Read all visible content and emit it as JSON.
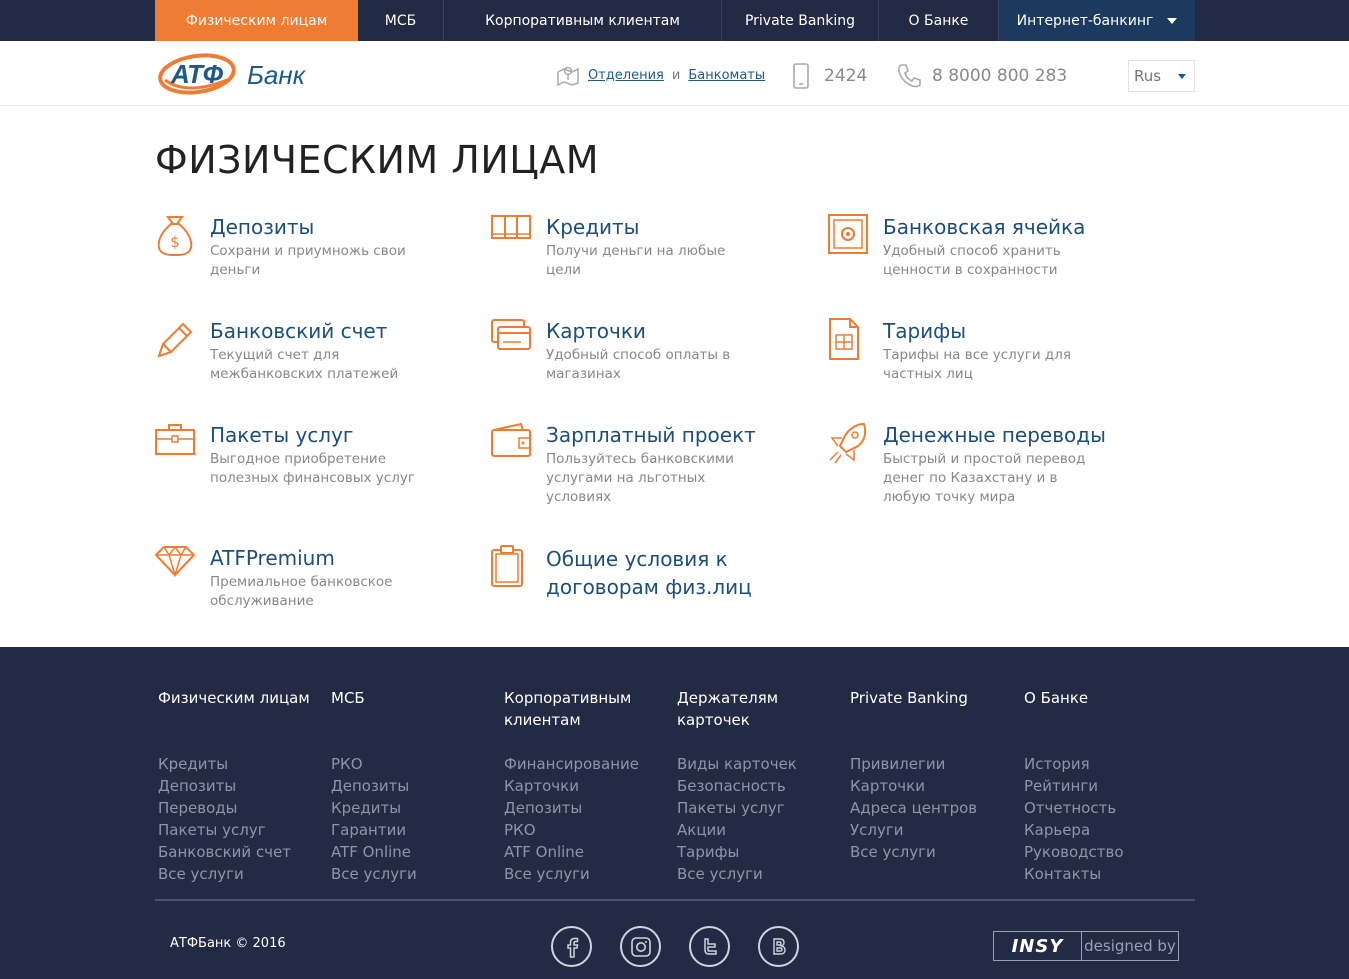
{
  "topnav": {
    "items": [
      {
        "label": "Физическим лицам"
      },
      {
        "label": "МСБ"
      },
      {
        "label": "Корпоративным клиентам"
      },
      {
        "label": "Private Banking"
      },
      {
        "label": "О Банке"
      },
      {
        "label": "Интернет-банкинг"
      }
    ]
  },
  "header": {
    "logo_text_1": "АТФ",
    "logo_text_2": "Банк",
    "branches_link": "Отделения",
    "branches_and": "и",
    "atms_link": "Банкоматы",
    "phone_short": "2424",
    "phone_long": "8 8000 800 283",
    "lang": "Rus"
  },
  "main": {
    "title": "ФИЗИЧЕСКИМ ЛИЦАМ",
    "services": [
      {
        "title": "Депозиты",
        "desc": "Сохрани и приумножь свои деньги",
        "icon": "money-bag-icon"
      },
      {
        "title": "Кредиты",
        "desc": "Получи деньги на любые цели",
        "icon": "book-icon"
      },
      {
        "title": "Банковская ячейка",
        "desc": "Удобный способ хранить ценности в сохранности",
        "icon": "safe-icon"
      },
      {
        "title": "Банковский счет",
        "desc": "Текущий счет для межбанковских платежей",
        "icon": "pen-icon"
      },
      {
        "title": "Карточки",
        "desc": "Удобный способ оплаты в магазинах",
        "icon": "cards-icon"
      },
      {
        "title": "Тарифы",
        "desc": "Тарифы на все услуги для частных лиц",
        "icon": "document-icon"
      },
      {
        "title": "Пакеты услуг",
        "desc": "Выгодное приобретение полезных финансовых услуг",
        "icon": "briefcase-icon"
      },
      {
        "title": "Зарплатный проект",
        "desc": "Пользуйтесь банковскими услугами на льготных условиях",
        "icon": "wallet-icon"
      },
      {
        "title": "Денежные переводы",
        "desc": "Быстрый и простой перевод денег по Казахстану и в любую точку мира",
        "icon": "rocket-icon"
      },
      {
        "title": "ATFPremium",
        "desc": "Премиальное банковское обслуживание",
        "icon": "diamond-icon"
      },
      {
        "title": "Общие условия к договорам физ.лиц",
        "desc": "",
        "icon": "clipboard-icon"
      }
    ]
  },
  "footer": {
    "columns": [
      {
        "head": "Физическим лицам",
        "links": [
          "Кредиты",
          "Депозиты",
          "Переводы",
          "Пакеты услуг",
          "Банковский счет",
          "Все услуги"
        ]
      },
      {
        "head": "МСБ",
        "links": [
          "РКО",
          "Депозиты",
          "Кредиты",
          "Гарантии",
          "ATF Online",
          "Все услуги"
        ]
      },
      {
        "head": "Корпоративным клиентам",
        "links": [
          "Финансирование",
          "Карточки",
          "Депозиты",
          "РКО",
          "ATF Online",
          "Все услуги"
        ]
      },
      {
        "head": "Держателям карточек",
        "links": [
          "Виды карточек",
          "Безопасность",
          "Пакеты услуг",
          "Акции",
          "Тарифы",
          "Все услуги"
        ]
      },
      {
        "head": "Private Banking",
        "links": [
          "Привилегии",
          "Карточки",
          "Адреса центров",
          "Услуги",
          "Все услуги"
        ]
      },
      {
        "head": "О Банке",
        "links": [
          "История",
          "Рейтинги",
          "Отчетность",
          "Карьера",
          "Руководство",
          "Контакты"
        ]
      }
    ],
    "copyright": "АТФБанк © 2016",
    "socials": [
      "facebook-icon",
      "instagram-icon",
      "twitter-icon",
      "vk-icon"
    ],
    "insy_brand": "INSY",
    "designed_by": "designed by"
  },
  "colors": {
    "accent": "#f07c33",
    "nav_bg": "#232a44",
    "link_blue": "#1c4e7c"
  }
}
